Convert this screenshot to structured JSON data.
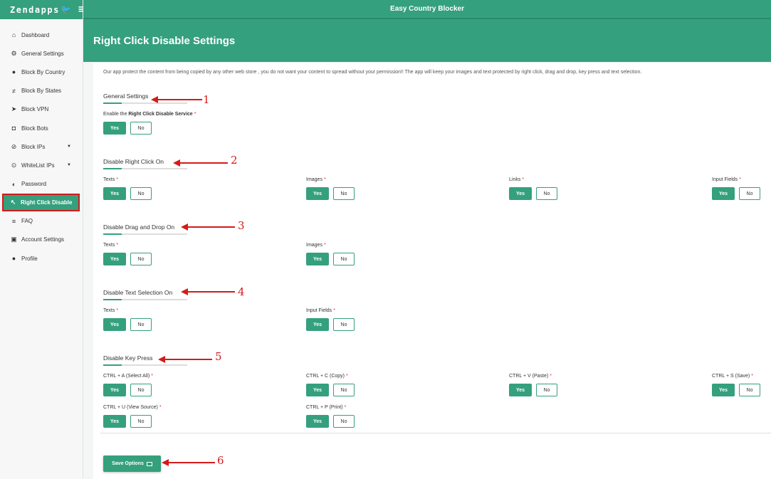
{
  "brand": {
    "name": "Zendapps",
    "menu_icon": "hamburger-icon"
  },
  "topbar": {
    "title": "Easy Country Blocker"
  },
  "sidebar": {
    "items": [
      {
        "label": "Dashboard",
        "icon": "home-icon"
      },
      {
        "label": "General Settings",
        "icon": "gear-icon"
      },
      {
        "label": "Block By Country",
        "icon": "globe-icon"
      },
      {
        "label": "Block By States",
        "icon": "signpost-icon"
      },
      {
        "label": "Block VPN",
        "icon": "rocket-icon"
      },
      {
        "label": "Block Bots",
        "icon": "android-icon"
      },
      {
        "label": "Block IPs",
        "icon": "ban-icon"
      },
      {
        "label": "WhiteList IPs",
        "icon": "accessibility-icon"
      },
      {
        "label": "Password",
        "icon": "shield-icon"
      },
      {
        "label": "Right Click Disable",
        "icon": "cursor-icon"
      },
      {
        "label": "FAQ",
        "icon": "list-icon"
      },
      {
        "label": "Account Settings",
        "icon": "money-icon"
      },
      {
        "label": "Profile",
        "icon": "user-icon"
      }
    ]
  },
  "page": {
    "title": "Right Click Disable Settings",
    "intro": "Our app protect the content from being copied by any other web store , you do not want your content to spread without your permission!! The app will keep your images and text protected by right click, drag and drop, key press and text selection."
  },
  "toggle": {
    "yes": "Yes",
    "no": "No"
  },
  "sections": {
    "general": {
      "title": "General Settings",
      "label_prefix": "Enable the ",
      "label_bold": "Right Click Disable Service",
      "req": "*"
    },
    "right_click": {
      "title": "Disable Right Click On",
      "fields": [
        "Texts",
        "Images",
        "Links",
        "Input Fields"
      ]
    },
    "drag_drop": {
      "title": "Disable Drag and Drop On",
      "fields": [
        "Texts",
        "Images"
      ]
    },
    "text_selection": {
      "title": "Disable Text Selection On",
      "fields": [
        "Texts",
        "Input Fields"
      ]
    },
    "key_press": {
      "title": "Disable Key Press",
      "fields": [
        "CTRL + A (Select All)",
        "CTRL + C (Copy)",
        "CTRL + V (Paste)",
        "CTRL + S (Save)",
        "CTRL + U (View Source)",
        "CTRL + P (Print)"
      ]
    }
  },
  "save": {
    "label": "Save Options"
  },
  "annotations": [
    "1",
    "2",
    "3",
    "4",
    "5",
    "6"
  ],
  "colors": {
    "accent": "#35a07d",
    "annotation": "#d41b1b",
    "required": "#e03131"
  }
}
